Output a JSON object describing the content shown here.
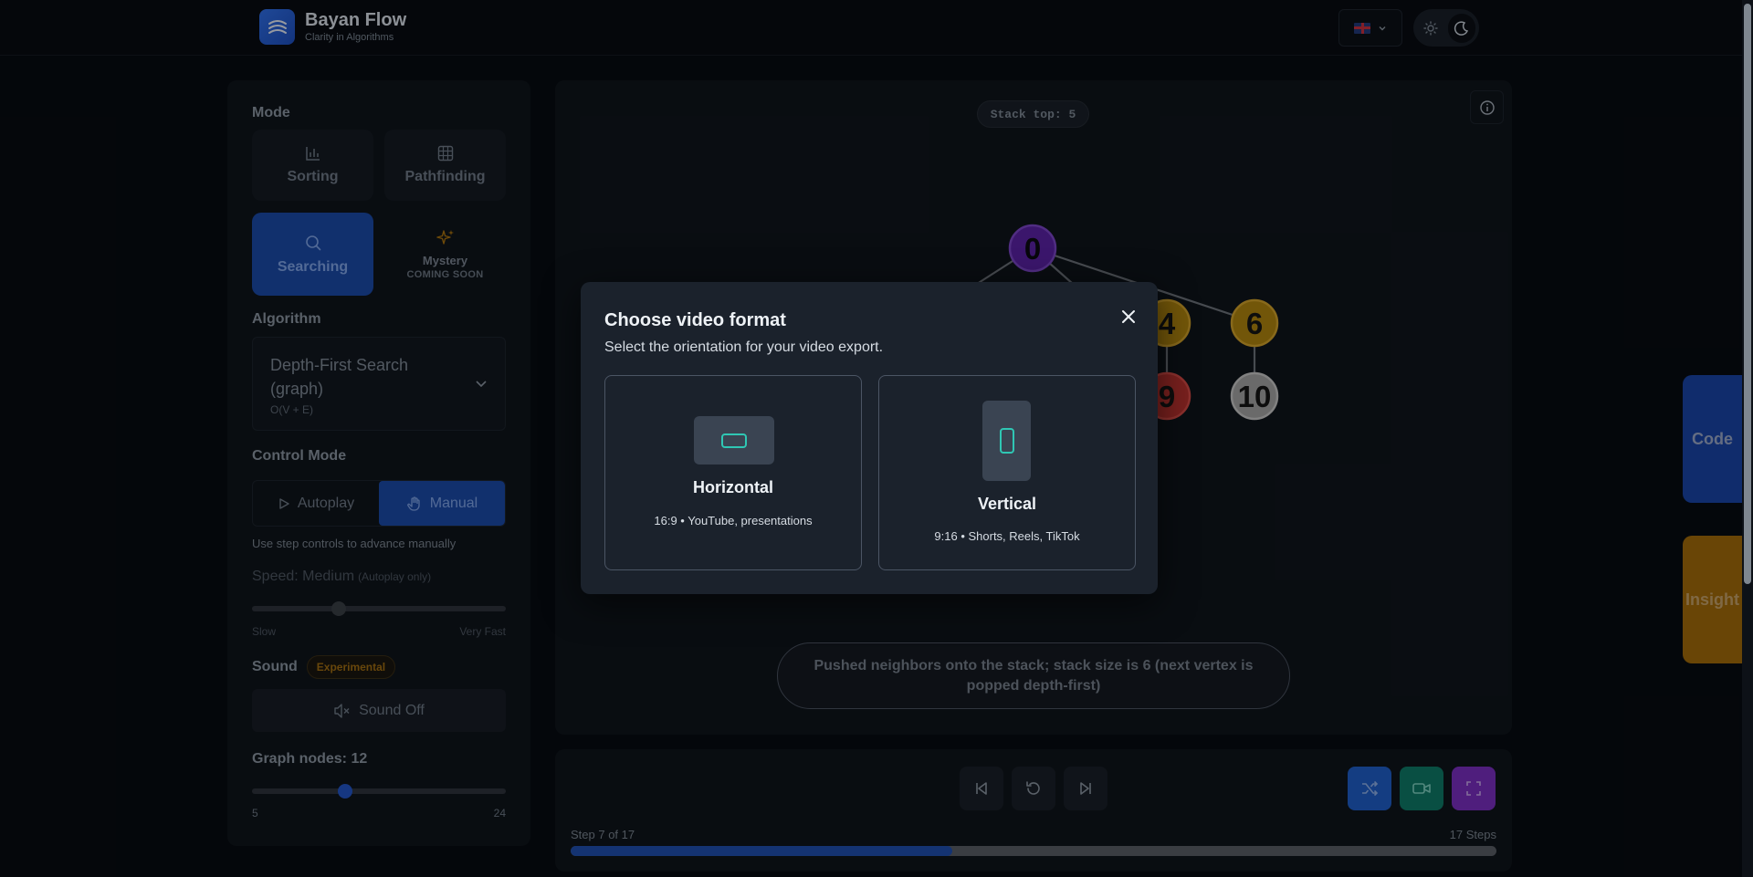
{
  "brand": {
    "name": "Bayan Flow",
    "tagline": "Clarity in Algorithms"
  },
  "header": {
    "language_icon": "uk-flag",
    "theme_options": [
      "sun-icon",
      "moon-icon"
    ],
    "theme_active": "dark"
  },
  "sidebar": {
    "mode_label": "Mode",
    "modes": [
      {
        "label": "Sorting",
        "icon": "bar-chart-icon",
        "active": false
      },
      {
        "label": "Pathfinding",
        "icon": "grid-icon",
        "active": false
      },
      {
        "label": "Searching",
        "icon": "search-icon",
        "active": true
      }
    ],
    "mystery": {
      "label": "Mystery",
      "sub": "COMING SOON"
    },
    "algorithm_label": "Algorithm",
    "algorithm": {
      "name": "Depth-First Search (graph)",
      "complexity": "O(V + E)"
    },
    "control_mode_label": "Control Mode",
    "control_modes": [
      {
        "label": "Autoplay",
        "active": false
      },
      {
        "label": "Manual",
        "active": true
      }
    ],
    "control_hint": "Use step controls to advance manually",
    "speed": {
      "label": "Speed: Medium",
      "note": "(Autoplay only)",
      "min_label": "Slow",
      "max_label": "Very Fast",
      "level": 0.34
    },
    "sound": {
      "label": "Sound",
      "badge": "Experimental",
      "button": "Sound Off"
    },
    "graph_nodes": {
      "label": "Graph nodes: 12",
      "min": "5",
      "max": "24",
      "value": 12
    }
  },
  "canvas": {
    "stack_top": "Stack top: 5",
    "status": "Pushed neighbors onto the stack; stack size is 6 (next vertex is popped depth-first)",
    "nodes": [
      {
        "id": "0",
        "color": "#5b22a6",
        "text": "#0b0b12"
      },
      {
        "id": "4",
        "color": "#b0840f",
        "text": "#151515"
      },
      {
        "id": "6",
        "color": "#b0840f",
        "text": "#151515"
      },
      {
        "id": "9",
        "color": "#b8322e",
        "text": "#151515"
      },
      {
        "id": "10",
        "color": "#a4a4a4",
        "text": "#151515"
      }
    ]
  },
  "playback": {
    "step_text": "Step 7 of 17",
    "total_steps": "17 Steps",
    "current_step": 7,
    "step_count": 17
  },
  "side_tabs": {
    "code": "Code",
    "insight": "Insight"
  },
  "modal": {
    "title": "Choose video format",
    "subtitle": "Select the orientation for your video export.",
    "options": [
      {
        "name": "Horizontal",
        "desc": "16:9 • YouTube, presentations"
      },
      {
        "name": "Vertical",
        "desc": "9:16 • Shorts, Reels, TikTok"
      }
    ]
  },
  "colors": {
    "accent_blue": "#1b4aa8",
    "teal_icon": "#2fc7b4",
    "video_btn": "#0f7a67",
    "fullscreen_btn": "#7a2fc0",
    "shuffle_btn": "#1f5fc8"
  }
}
